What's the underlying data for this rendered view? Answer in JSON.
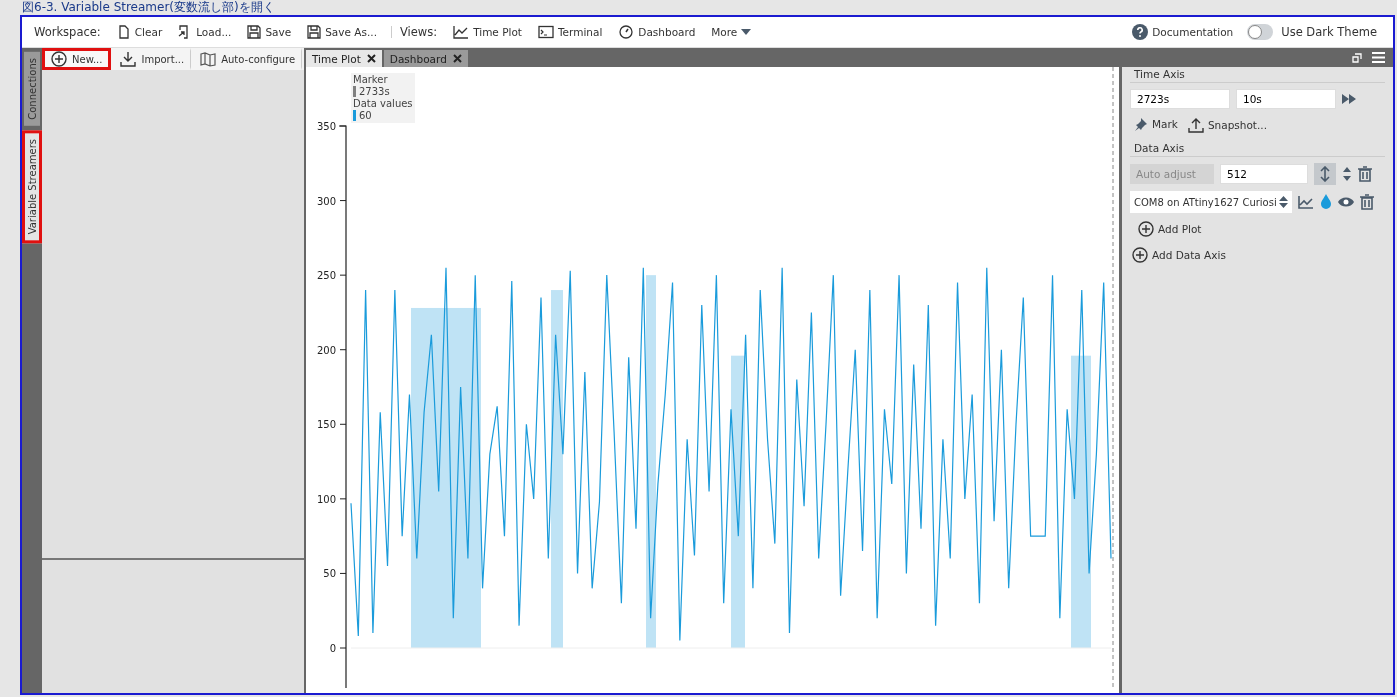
{
  "caption": "図6-3. Variable Streamer(変数流し部)を開く",
  "toolbar": {
    "workspace_label": "Workspace:",
    "workspace_buttons": [
      {
        "label": "Clear"
      },
      {
        "label": "Load..."
      },
      {
        "label": "Save"
      },
      {
        "label": "Save As..."
      }
    ],
    "views_label": "Views:",
    "view_buttons": [
      {
        "label": "Time Plot"
      },
      {
        "label": "Terminal"
      },
      {
        "label": "Dashboard"
      }
    ],
    "more": "More",
    "documentation": "Documentation",
    "dark_theme": {
      "label": "Use Dark Theme",
      "on": false
    }
  },
  "side_tabs": [
    {
      "label": "Connections",
      "selected": false,
      "highlighted": false
    },
    {
      "label": "Variable Streamers",
      "selected": true,
      "highlighted": true
    }
  ],
  "left_toolbar": [
    {
      "label": "New...",
      "highlighted": true
    },
    {
      "label": "Import...",
      "highlighted": false
    },
    {
      "label": "Auto-configure",
      "highlighted": false
    }
  ],
  "doc_tabs": [
    {
      "label": "Time Plot",
      "selected": true
    },
    {
      "label": "Dashboard",
      "selected": false
    }
  ],
  "plot": {
    "legend": [
      {
        "title": "Marker",
        "value": "2733s",
        "color": "#808080"
      },
      {
        "title": "Data values",
        "value": "60",
        "color": "#1a9bdb"
      }
    ],
    "chart_data": {
      "type": "line",
      "ylim": [
        0,
        350
      ],
      "yticks": [
        0,
        50,
        100,
        150,
        200,
        250,
        300,
        350
      ],
      "series": [
        {
          "color": "#1a9bdb",
          "values": [
            97,
            8,
            240,
            10,
            158,
            55,
            240,
            75,
            170,
            60,
            158,
            210,
            105,
            255,
            20,
            175,
            60,
            250,
            40,
            130,
            162,
            75,
            246,
            15,
            150,
            100,
            235,
            60,
            210,
            130,
            253,
            50,
            185,
            40,
            98,
            250,
            145,
            30,
            195,
            80,
            255,
            20,
            110,
            170,
            245,
            5,
            140,
            62,
            230,
            105,
            250,
            30,
            160,
            75,
            210,
            40,
            240,
            140,
            70,
            255,
            10,
            180,
            95,
            225,
            60,
            150,
            250,
            35,
            120,
            200,
            65,
            240,
            20,
            160,
            110,
            250,
            50,
            190,
            80,
            230,
            15,
            140,
            60,
            245,
            100,
            170,
            30,
            255,
            85,
            200,
            40,
            150,
            235,
            75,
            75,
            75,
            250,
            20,
            160,
            100,
            240,
            50,
            130,
            245,
            60
          ]
        }
      ]
    }
  },
  "right_panel": {
    "time_axis": {
      "title": "Time Axis",
      "start": "2723s",
      "span": "10s",
      "mark": "Mark",
      "snapshot": "Snapshot..."
    },
    "data_axis": {
      "title": "Data Axis",
      "auto_adjust": "Auto adjust",
      "max": "512",
      "source": "COM8 on ATtiny1627 Curiosi",
      "add_plot": "Add Plot"
    },
    "add_data_axis": "Add Data Axis"
  }
}
